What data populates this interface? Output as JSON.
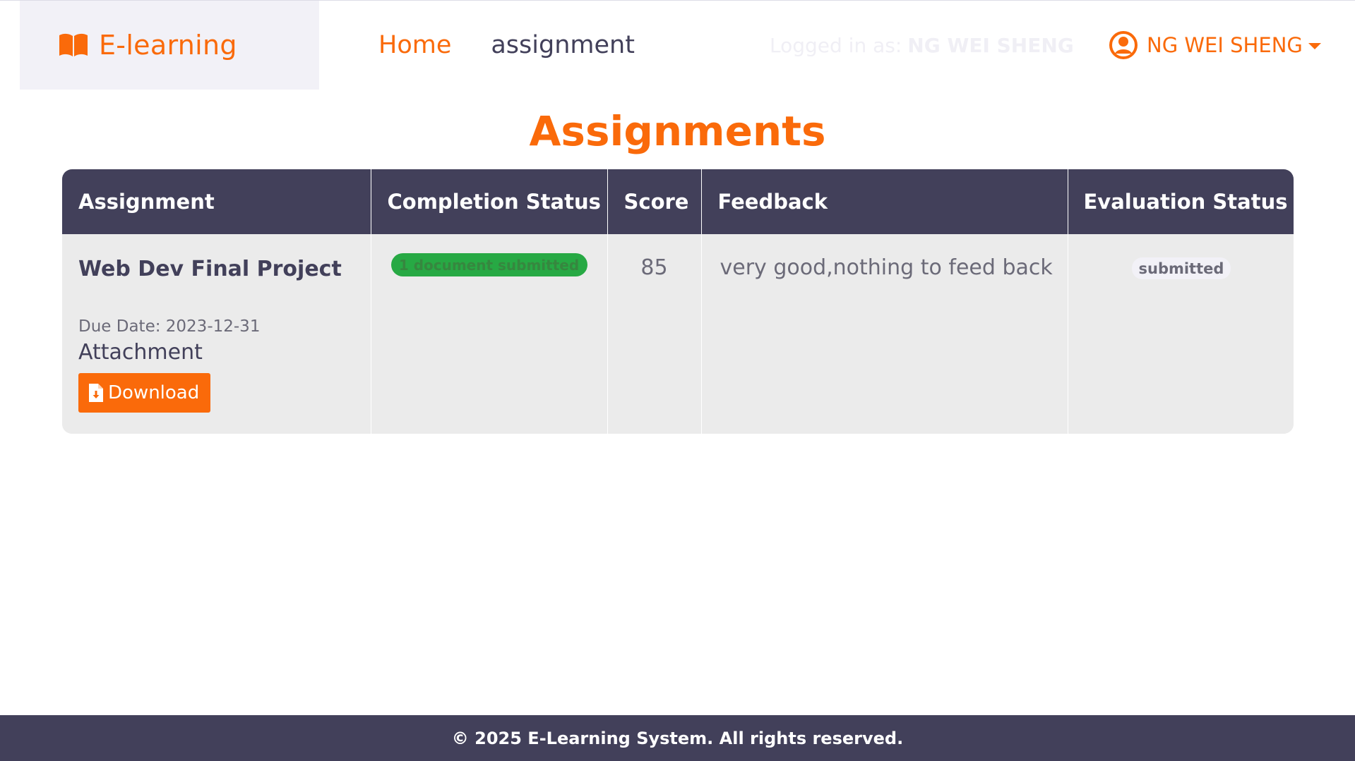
{
  "brand": {
    "name": "E-learning"
  },
  "nav": {
    "home": "Home",
    "assignment": "assignment"
  },
  "user": {
    "logged_in_prefix": "Logged in as:",
    "logged_in_name": "NG WEI SHENG",
    "menu_name": "NG WEI SHENG"
  },
  "page": {
    "title": "Assignments"
  },
  "table": {
    "headers": {
      "assignment": "Assignment",
      "completion": "Completion Status",
      "score": "Score",
      "feedback": "Feedback",
      "evaluation": "Evaluation Status"
    },
    "rows": [
      {
        "title": "Web Dev Final Project",
        "due": "Due Date: 2023-12-31",
        "attachment_label": "Attachment",
        "download_label": "Download",
        "completion_status": "1 document submitted",
        "score": "85",
        "feedback": "very good,nothing to feed back",
        "evaluation_status": "submitted"
      }
    ]
  },
  "footer": {
    "text": "© 2025 E-Learning System. All rights reserved."
  },
  "colors": {
    "accent": "#fa6a0a",
    "dark": "#42405a",
    "success": "#27a944"
  },
  "icons": [
    "book-open-icon",
    "user-circle-icon",
    "caret-down-icon",
    "upload-icon",
    "file-download-icon"
  ]
}
